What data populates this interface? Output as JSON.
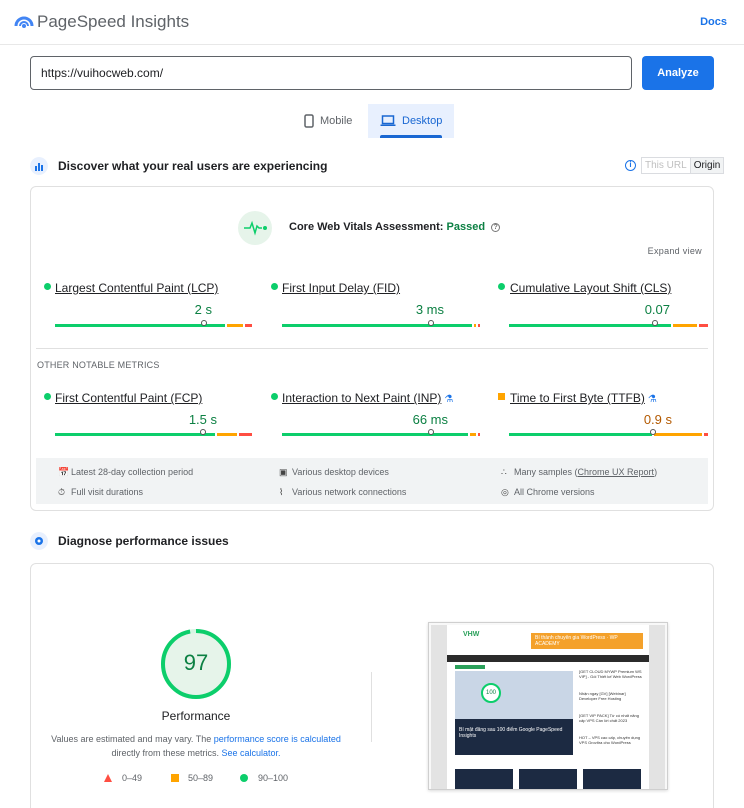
{
  "header": {
    "brand": "PageSpeed Insights",
    "docs_label": "Docs"
  },
  "search": {
    "url_value": "https://vuihocweb.com/",
    "analyze_label": "Analyze"
  },
  "tabs": [
    {
      "label": "Mobile",
      "active": false
    },
    {
      "label": "Desktop",
      "active": true
    }
  ],
  "field_data": {
    "title": "Discover what your real users are experiencing",
    "toggle": {
      "this_url": "This URL",
      "origin": "Origin"
    },
    "assessment_label": "Core Web Vitals Assessment:",
    "assessment_status": "Passed",
    "expand_label": "Expand view",
    "core_metrics": [
      {
        "name": "Largest Contentful Paint (LCP)",
        "value": "2 s",
        "status": "good",
        "good_share": 0.85
      },
      {
        "name": "First Input Delay (FID)",
        "value": "3 ms",
        "status": "good",
        "good_share": 0.97
      },
      {
        "name": "Cumulative Layout Shift (CLS)",
        "value": "0.07",
        "status": "good",
        "good_share": 0.82
      }
    ],
    "other_label": "OTHER NOTABLE METRICS",
    "other_metrics": [
      {
        "name": "First Contentful Paint (FCP)",
        "value": "1.5 s",
        "status": "good",
        "experimental": false,
        "good_share": 0.8
      },
      {
        "name": "Interaction to Next Paint (INP)",
        "value": "66 ms",
        "status": "good",
        "experimental": true,
        "good_share": 0.94
      },
      {
        "name": "Time to First Byte (TTFB)",
        "value": "0.9 s",
        "status": "average",
        "experimental": true,
        "good_share": 0.72
      }
    ],
    "footer": {
      "period": "Latest 28-day collection period",
      "devices": "Various desktop devices",
      "samples_prefix": "Many samples (",
      "samples_link": "Chrome UX Report",
      "samples_suffix": ")",
      "durations": "Full visit durations",
      "connections": "Various network connections",
      "versions": "All Chrome versions"
    }
  },
  "diagnose": {
    "title": "Diagnose performance issues",
    "score": "97",
    "score_value": 97,
    "category": "Performance",
    "note_prefix": "Values are estimated and may vary. The ",
    "note_link1": "performance score is calculated",
    "note_middle": "directly from these metrics. ",
    "note_link2": "See calculator.",
    "legend": {
      "poor": "0–49",
      "average": "50–89",
      "good": "90–100"
    }
  },
  "thumbnail": {
    "logo": "VHW",
    "banner": "Bí thành chuyên gia WordPress · WP ACADEMY",
    "hero_score": "100",
    "hero_caption": "Bí mật đăng sau 100 điểm Google PageSpeed Insights",
    "side_items": [
      "[GET CLOUD MYWP Premium WS VIP] - Gói Thiết kế Web WordPress",
      "Nhận ngay [GV] [Webinar] Developer Free Hosting",
      "[GET VIP PACK] Từ có nhất năng cấp VPS Cần lời chất 2023",
      "HOT – VPS cao cấp, chuyên dụng VPS Grovltra cho WordPress"
    ],
    "colors": {
      "good": "#0cce6b",
      "average": "#ffa400",
      "poor": "#ff4e42",
      "accent": "#1a73e8"
    }
  }
}
